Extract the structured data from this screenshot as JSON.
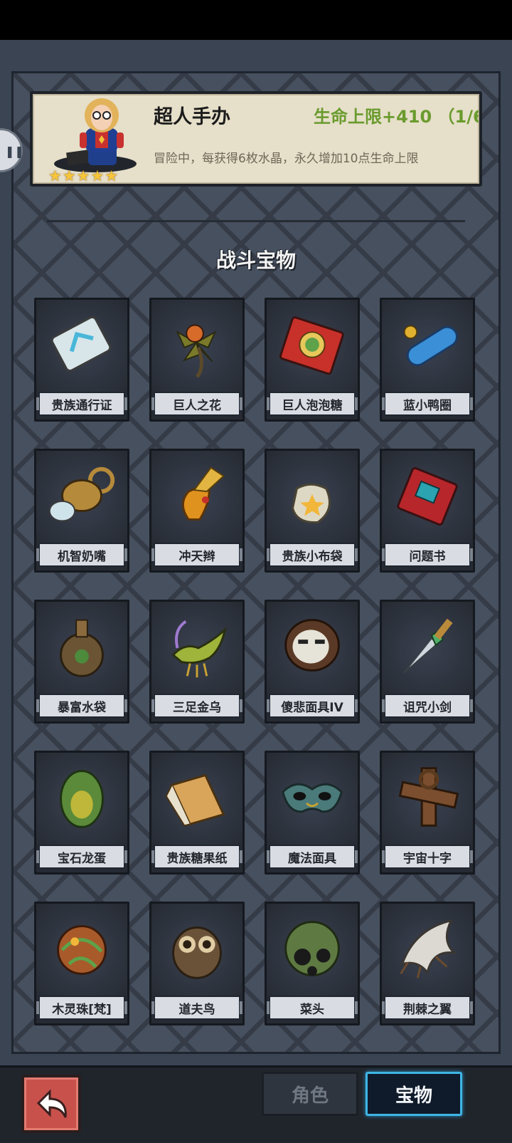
{
  "hero": {
    "name": "超人手办",
    "bonus": "生命上限+410 （1/6",
    "description": "冒险中，每获得6枚水晶，永久增加10点生命上限",
    "stars": 5,
    "icon": "hero-figure-icon"
  },
  "side_tab": {
    "icon": "pause-icon",
    "symbol": "❚❚"
  },
  "section_title": "战斗宝物",
  "items": [
    {
      "label": "贵族通行证",
      "icon": "noble-pass-card-icon"
    },
    {
      "label": "巨人之花",
      "icon": "giant-flower-icon"
    },
    {
      "label": "巨人泡泡糖",
      "icon": "giant-bubblegum-icon"
    },
    {
      "label": "蓝小鸭圈",
      "icon": "blue-duck-ring-icon"
    },
    {
      "label": "机智奶嘴",
      "icon": "pacifier-icon"
    },
    {
      "label": "冲天辫",
      "icon": "pigtail-icon"
    },
    {
      "label": "贵族小布袋",
      "icon": "cloth-pouch-icon"
    },
    {
      "label": "问题书",
      "icon": "question-book-icon"
    },
    {
      "label": "暴富水袋",
      "icon": "water-flask-icon"
    },
    {
      "label": "三足金乌",
      "icon": "golden-crow-icon"
    },
    {
      "label": "傻悲面具IV",
      "icon": "sad-mask-icon"
    },
    {
      "label": "诅咒小剑",
      "icon": "cursed-dagger-icon"
    },
    {
      "label": "宝石龙蛋",
      "icon": "dragon-egg-icon"
    },
    {
      "label": "贵族糖果纸",
      "icon": "candy-wrapper-icon"
    },
    {
      "label": "魔法面具",
      "icon": "magic-mask-icon"
    },
    {
      "label": "宇宙十字",
      "icon": "cosmic-cross-icon"
    },
    {
      "label": "木灵珠[梵]",
      "icon": "wood-spirit-orb-icon"
    },
    {
      "label": "道夫鸟",
      "icon": "owl-icon"
    },
    {
      "label": "菜头",
      "icon": "veggie-head-icon"
    },
    {
      "label": "荆棘之翼",
      "icon": "thorn-wing-icon"
    }
  ],
  "nav": {
    "back_icon": "back-arrow-icon",
    "tab_role": "角色",
    "tab_treasure": "宝物"
  }
}
